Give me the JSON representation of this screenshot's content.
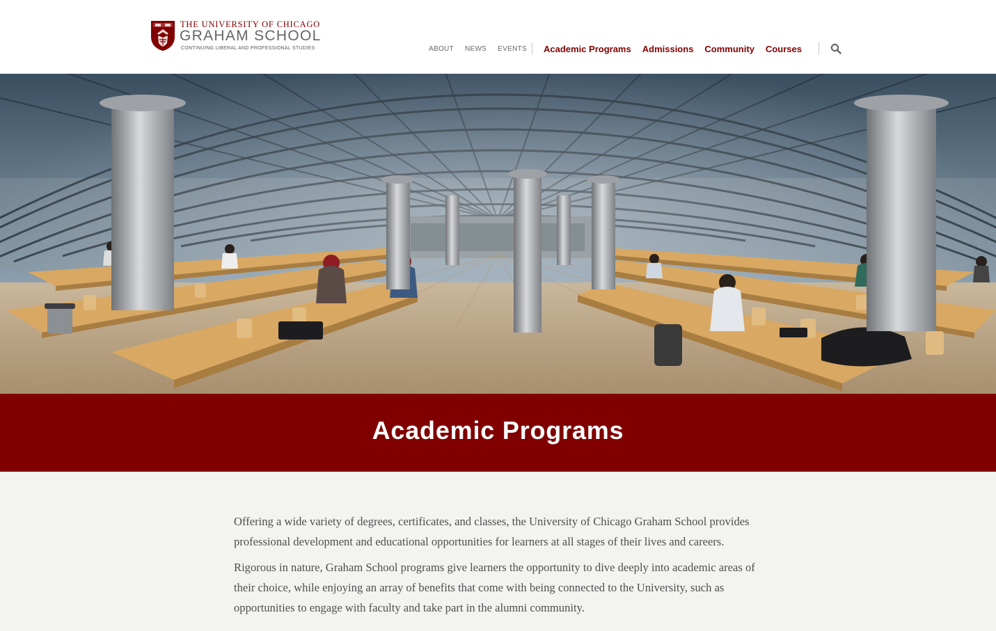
{
  "logo": {
    "line1": "THE UNIVERSITY OF CHICAGO",
    "line2": "GRAHAM SCHOOL",
    "line3": "CONTINUING LIBERAL AND PROFESSIONAL STUDIES",
    "icon": "university-shield-icon"
  },
  "utility_nav": {
    "about": "ABOUT",
    "news": "NEWS",
    "events": "EVENTS"
  },
  "main_nav": {
    "academic_programs": "Academic Programs",
    "admissions": "Admissions",
    "community": "Community",
    "courses": "Courses"
  },
  "search": {
    "icon": "search-icon"
  },
  "hero": {
    "image": "library-reading-room-glass-dome"
  },
  "title": "Academic Programs",
  "intro": {
    "p1": "Offering a wide variety of degrees, certificates, and classes, the University of Chicago Graham School provides professional development and educational opportunities for learners at all stages of their lives and careers.",
    "p2": "Rigorous in nature, Graham School programs give learners the opportunity to dive deeply into academic areas of their choice, while enjoying an array of benefits that come with being connected to the University, such as opportunities to engage with faculty and take part in the alumni community."
  },
  "colors": {
    "brand_maroon": "#800000",
    "nav_gray": "#666666",
    "body_text": "#4f4f4f",
    "page_background": "#f3f3f1"
  }
}
